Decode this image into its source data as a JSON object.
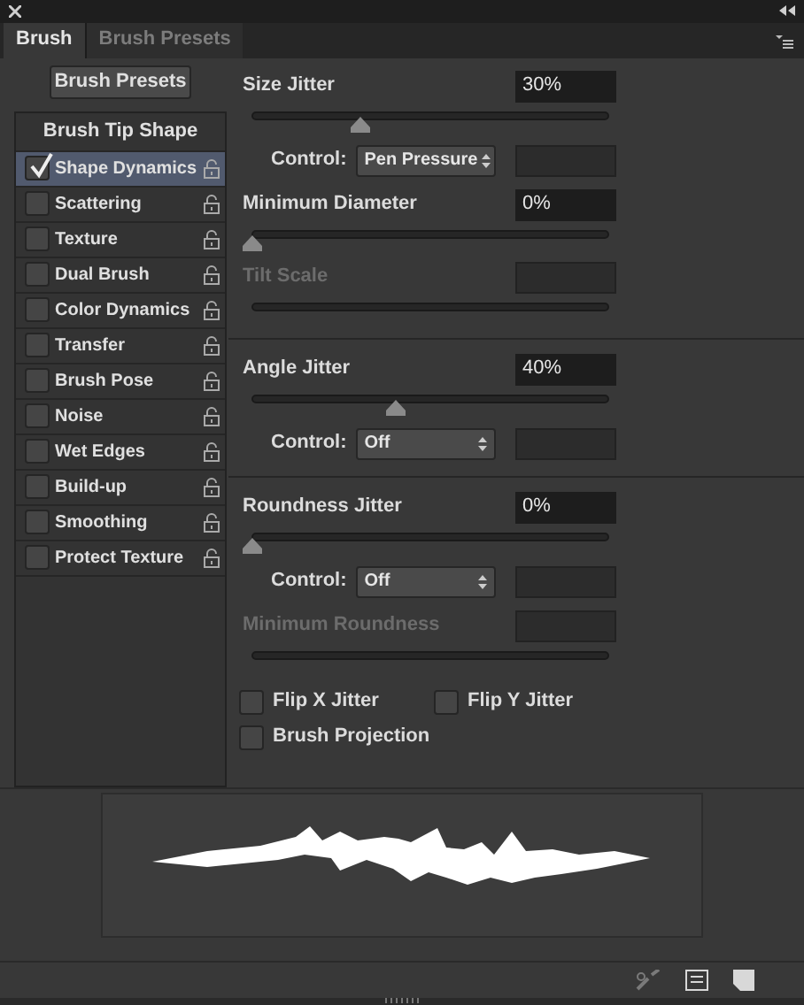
{
  "tabs": [
    {
      "label": "Brush",
      "selected": true
    },
    {
      "label": "Brush Presets",
      "selected": false
    }
  ],
  "presets_button": "Brush Presets",
  "sidebar": {
    "items": [
      {
        "kind": "header",
        "label": "Brush Tip Shape",
        "selected": false
      },
      {
        "kind": "option",
        "label": "Shape Dynamics",
        "checked": true,
        "selected": true
      },
      {
        "kind": "option",
        "label": "Scattering",
        "checked": false,
        "selected": false
      },
      {
        "kind": "option",
        "label": "Texture",
        "checked": false,
        "selected": false
      },
      {
        "kind": "option",
        "label": "Dual Brush",
        "checked": false,
        "selected": false
      },
      {
        "kind": "option",
        "label": "Color Dynamics",
        "checked": false,
        "selected": false
      },
      {
        "kind": "option",
        "label": "Transfer",
        "checked": false,
        "selected": false
      },
      {
        "kind": "option",
        "label": "Brush Pose",
        "checked": false,
        "selected": false
      },
      {
        "kind": "option",
        "label": "Noise",
        "checked": false,
        "selected": false
      },
      {
        "kind": "option",
        "label": "Wet Edges",
        "checked": false,
        "selected": false
      },
      {
        "kind": "option",
        "label": "Build-up",
        "checked": false,
        "selected": false
      },
      {
        "kind": "option",
        "label": "Smoothing",
        "checked": false,
        "selected": false
      },
      {
        "kind": "option",
        "label": "Protect Texture",
        "checked": false,
        "selected": false
      }
    ]
  },
  "settings": [
    {
      "kind": "value",
      "label": "Size Jitter",
      "value": "30%",
      "disabled": false
    },
    {
      "kind": "slider",
      "level": 0.3
    },
    {
      "kind": "control",
      "label": "Control:",
      "value": "Pen Pressure"
    },
    {
      "kind": "value",
      "label": "Minimum Diameter",
      "value": "0%",
      "disabled": false
    },
    {
      "kind": "slider",
      "level": 0
    },
    {
      "kind": "value",
      "label": "Tilt Scale",
      "disabled": true
    },
    {
      "kind": "slider"
    },
    {
      "kind": "divider"
    },
    {
      "kind": "value",
      "label": "Angle Jitter",
      "value": "40%",
      "disabled": false
    },
    {
      "kind": "slider",
      "level": 0.4
    },
    {
      "kind": "control",
      "label": "Control:",
      "value": "Off"
    },
    {
      "kind": "divider"
    },
    {
      "kind": "value",
      "label": "Roundness Jitter",
      "value": "0%",
      "disabled": false
    },
    {
      "kind": "slider",
      "level": 0
    },
    {
      "kind": "control",
      "label": "Control:",
      "value": "Off"
    },
    {
      "kind": "value",
      "label": "Minimum Roundness",
      "disabled": true
    },
    {
      "kind": "slider"
    }
  ],
  "checkboxes": [
    {
      "label": "Flip X Jitter",
      "checked": false
    },
    {
      "label": "Flip Y Jitter",
      "checked": false
    },
    {
      "label": "Brush Projection",
      "checked": false
    }
  ]
}
